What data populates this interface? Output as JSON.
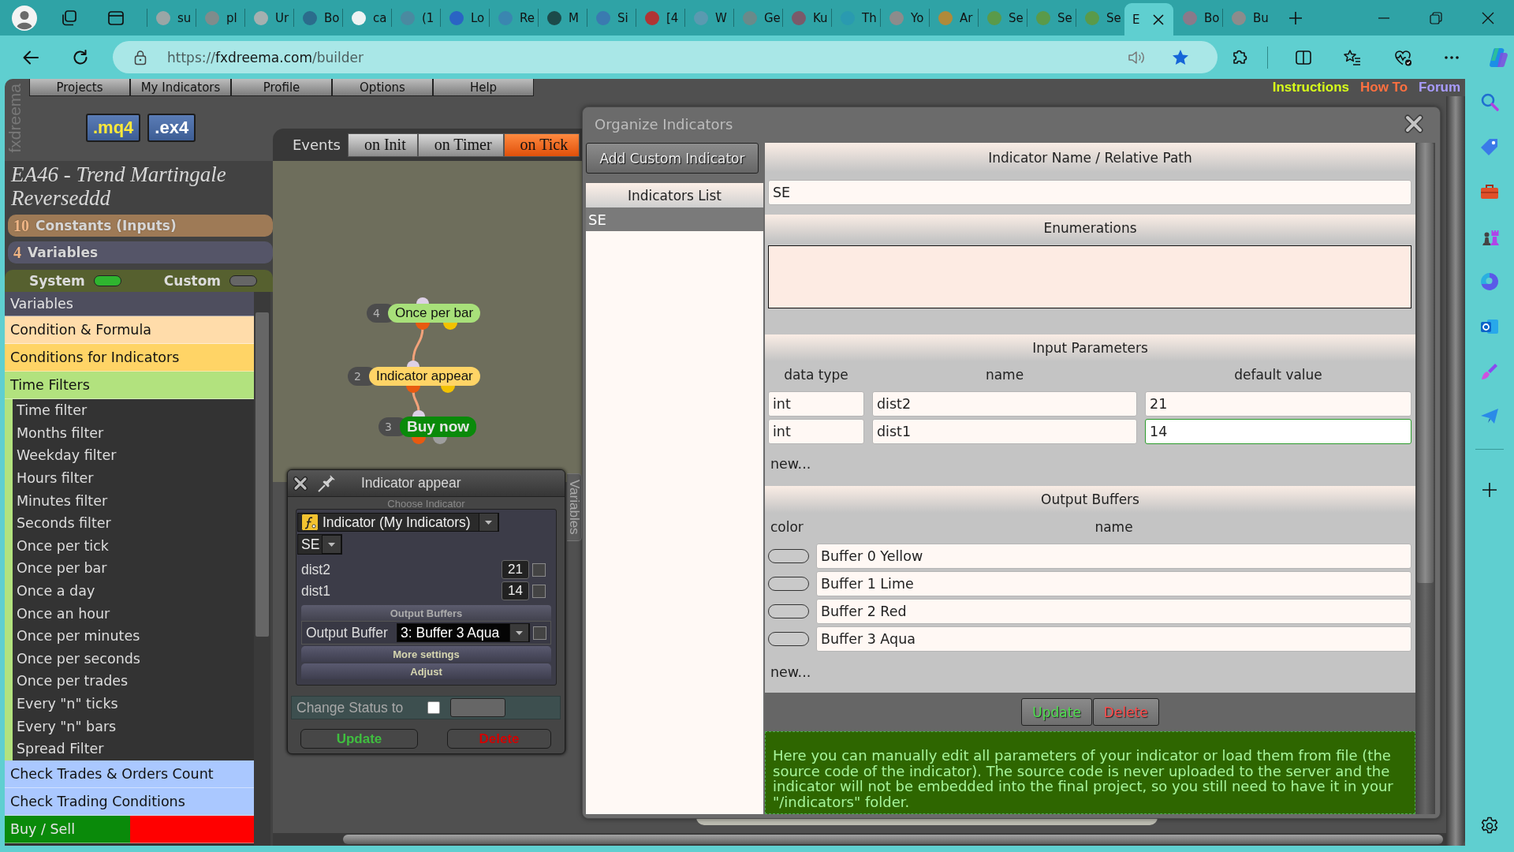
{
  "browser": {
    "tabs": [
      {
        "title": "su",
        "selected": false
      },
      {
        "title": "pl",
        "selected": false
      },
      {
        "title": "Ur",
        "selected": false
      },
      {
        "title": "Bo",
        "selected": false
      },
      {
        "title": "ca",
        "selected": false
      },
      {
        "title": "(1",
        "selected": false
      },
      {
        "title": "Lo",
        "selected": false
      },
      {
        "title": "Re",
        "selected": false
      },
      {
        "title": "M",
        "selected": false
      },
      {
        "title": "Si",
        "selected": false
      },
      {
        "title": "[4",
        "selected": false
      },
      {
        "title": "W",
        "selected": false
      },
      {
        "title": "Ge",
        "selected": false
      },
      {
        "title": "Ku",
        "selected": false
      },
      {
        "title": "Th",
        "selected": false
      },
      {
        "title": "Yo",
        "selected": false
      },
      {
        "title": "Ar",
        "selected": false
      },
      {
        "title": "Se",
        "selected": false
      },
      {
        "title": "Se",
        "selected": false
      },
      {
        "title": "Se",
        "selected": false
      },
      {
        "title": "E",
        "selected": true
      },
      {
        "title": "Bo",
        "selected": false
      },
      {
        "title": "Bu",
        "selected": false
      }
    ],
    "url": {
      "scheme": "https://",
      "host": "fxdreema.com",
      "path": "/builder"
    }
  },
  "app": {
    "logo": "fxdreema",
    "menu": [
      "Projects",
      "My Indicators",
      "Profile",
      "Options",
      "Help"
    ],
    "links": [
      {
        "label": "Instructions",
        "color": "#d8ff1a"
      },
      {
        "label": "How To",
        "color": "#ff7040"
      },
      {
        "label": "Forum",
        "color": "#a99cff"
      }
    ],
    "export_buttons": [
      {
        "label": ".mq4",
        "color": "#ffe93a"
      },
      {
        "label": ".ex4",
        "color": "#ffffff"
      }
    ]
  },
  "project": {
    "title": "EA46 - Trend Martingale Reverseddd",
    "sections": [
      {
        "count": "10",
        "label": "Constants (Inputs)",
        "color": "#9e7a56"
      },
      {
        "count": "4",
        "label": "Variables",
        "color": "#555568"
      }
    ],
    "toggles": [
      {
        "label": "System",
        "on": true
      },
      {
        "label": "Custom",
        "on": false
      }
    ],
    "blocks": [
      {
        "label": "Variables",
        "color": "#4e4e5e"
      },
      {
        "label": "Condition & Formula",
        "color": "#ffdcaa"
      },
      {
        "label": "Conditions for Indicators",
        "color": "#ffd466"
      },
      {
        "label": "Time Filters",
        "color": "#b2e27e",
        "children": [
          {
            "label": "Time filter"
          },
          {
            "label": "Months filter"
          },
          {
            "label": "Weekday filter"
          },
          {
            "label": "Hours filter"
          },
          {
            "label": "Minutes filter"
          },
          {
            "label": "Seconds filter"
          },
          {
            "label": "Once per tick"
          },
          {
            "label": "Once per bar"
          },
          {
            "label": "Once a day"
          },
          {
            "label": "Once an hour"
          },
          {
            "label": "Once per minutes"
          },
          {
            "label": "Once per seconds"
          },
          {
            "label": "Once per trades"
          },
          {
            "label": "Every \"n\" ticks"
          },
          {
            "label": "Every \"n\" bars"
          },
          {
            "label": "Spread Filter"
          }
        ]
      },
      {
        "label": "Check Trades & Orders Count",
        "color": "#aac8ff"
      },
      {
        "label": "Check Trading Conditions",
        "color": "#aac8ff"
      },
      {
        "label": "Buy / Sell",
        "color": "#0a8a0a",
        "side_block": {
          "color": "#ff0000"
        }
      }
    ]
  },
  "canvas": {
    "label": "Events",
    "tabs": [
      {
        "label": "on Init",
        "selected": false
      },
      {
        "label": "on Timer",
        "selected": false
      },
      {
        "label": "on Tick",
        "selected": true
      }
    ],
    "nodes": [
      {
        "number": "4",
        "label": "Once per bar",
        "color": "#a8e07a",
        "kind": "filter"
      },
      {
        "number": "2",
        "label": "Indicator appear",
        "color": "#ffd466",
        "kind": "condition"
      },
      {
        "number": "3",
        "label": "Buy now",
        "color": "#0a8a0a",
        "kind": "trade"
      }
    ]
  },
  "block_editor": {
    "title": "Indicator appear",
    "side_tab": "Variables",
    "choose_label": "Choose Indicator",
    "indicator_select": "Indicator (My Indicators)",
    "file_select": "SE",
    "params": [
      {
        "name": "dist2",
        "value": "21",
        "checked": false
      },
      {
        "name": "dist1",
        "value": "14",
        "checked": false
      }
    ],
    "buffers_heading": "Output Buffers",
    "buffer_label": "Output Buffer",
    "buffer_select": "3: Buffer 3 Aqua",
    "buffer_checked": false,
    "sections": [
      "More settings",
      "Adjust"
    ],
    "status_label": "Change Status to",
    "status_checked": false,
    "buttons": [
      {
        "label": "Update",
        "kind": "update"
      },
      {
        "label": "Delete",
        "kind": "delete"
      }
    ]
  },
  "organizer": {
    "title": "Organize Indicators",
    "add_button": "Add Custom Indicator",
    "list_heading": "Indicators List",
    "list": [
      {
        "label": "SE",
        "selected": true
      }
    ],
    "name_heading": "Indicator Name / Relative Path",
    "name_value": "SE",
    "enum_heading": "Enumerations",
    "params_heading": "Input Parameters",
    "param_columns": [
      "data type",
      "name",
      "default value"
    ],
    "params": [
      {
        "type": "int",
        "name": "dist2",
        "default": "21",
        "focused": false
      },
      {
        "type": "int",
        "name": "dist1",
        "default": "14",
        "focused": true
      }
    ],
    "new_param": "new...",
    "buffers_heading": "Output Buffers",
    "buffer_columns": [
      "color",
      "name"
    ],
    "buffers": [
      {
        "name": "Buffer 0 Yellow"
      },
      {
        "name": "Buffer 1 Lime"
      },
      {
        "name": "Buffer 2 Red"
      },
      {
        "name": "Buffer 3 Aqua"
      }
    ],
    "new_buffer": "new...",
    "buttons": [
      {
        "label": "Update",
        "kind": "update"
      },
      {
        "label": "Delete",
        "kind": "delete"
      }
    ],
    "info": "Here you can manually edit all parameters of your indicator or load them from file (the source code of the indicator). The source code is never uploaded to the server and the indicator will not be embedded into the final project, so you still need to have it in your \"/indicators\" folder."
  }
}
